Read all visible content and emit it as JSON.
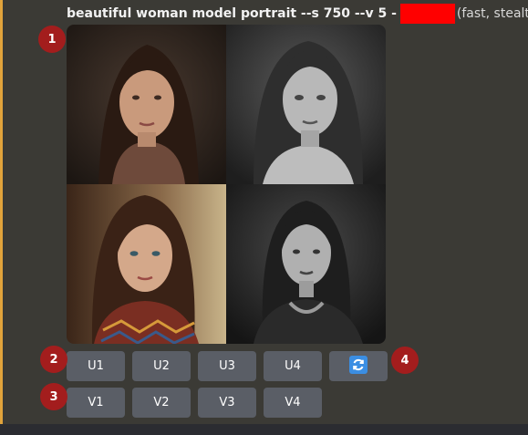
{
  "message": {
    "prompt": "beautiful woman model portrait --s 750 --v 5 -",
    "mode": "(fast, stealth)"
  },
  "upscale_buttons": [
    "U1",
    "U2",
    "U3",
    "U4"
  ],
  "variation_buttons": [
    "V1",
    "V2",
    "V3",
    "V4"
  ],
  "markers": [
    "1",
    "2",
    "3",
    "4"
  ],
  "icons": {
    "refresh": "refresh-icon"
  },
  "colors": {
    "background": "#3b3a35",
    "accent_bar": "#e1a33b",
    "button": "#5a5e66",
    "refresh_icon": "#3b8ee3",
    "marker": "#a31d1d",
    "redaction": "#ff0000"
  }
}
